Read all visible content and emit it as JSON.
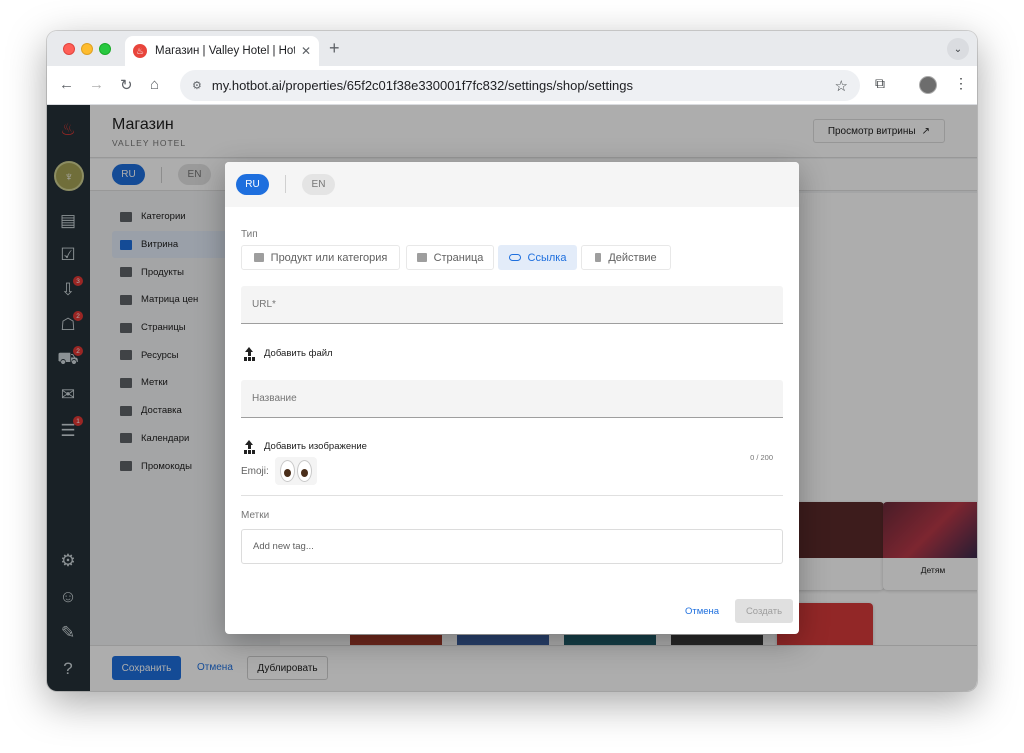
{
  "browser": {
    "tab_title": "Магазин | Valley Hotel | Hotbot",
    "url": "my.hotbot.ai/properties/65f2c01f38e330001f7fc832/settings/shop/settings"
  },
  "rail": {
    "badges": {
      "inbox": "3",
      "bot": "2",
      "cart": "2",
      "chat": "1"
    }
  },
  "page": {
    "title": "Магазин",
    "subtitle": "VALLEY HOTEL",
    "preview_label": "Просмотр витрины",
    "preview_arrow": "↗",
    "lang_ru": "RU",
    "lang_en": "EN"
  },
  "menu": {
    "items": [
      {
        "label": "Категории"
      },
      {
        "label": "Витрина"
      },
      {
        "label": "Продукты"
      },
      {
        "label": "Матрица цен"
      },
      {
        "label": "Страницы"
      },
      {
        "label": "Ресурсы"
      },
      {
        "label": "Метки"
      },
      {
        "label": "Доставка"
      },
      {
        "label": "Календари"
      },
      {
        "label": "Промокоды"
      }
    ]
  },
  "content": {
    "card_label": "Детям"
  },
  "footer": {
    "save": "Сохранить",
    "cancel": "Отмена",
    "duplicate": "Дублировать"
  },
  "modal": {
    "lang_ru": "RU",
    "lang_en": "EN",
    "type_label": "Тип",
    "types": [
      {
        "label": "Продукт или категория"
      },
      {
        "label": "Страница"
      },
      {
        "label": "Ссылка"
      },
      {
        "label": "Действие"
      }
    ],
    "url_placeholder": "URL*",
    "add_file": "Добавить файл",
    "name_placeholder": "Название",
    "name_counter": "0 / 200",
    "add_image": "Добавить изображение",
    "emoji_label": "Emoji:",
    "tags_label": "Метки",
    "tags_placeholder": "Add new tag...",
    "cancel": "Отмена",
    "create": "Создать"
  },
  "colors": {
    "accent": "#1e6fde",
    "rail": "#263238",
    "badge": "#e53935"
  }
}
